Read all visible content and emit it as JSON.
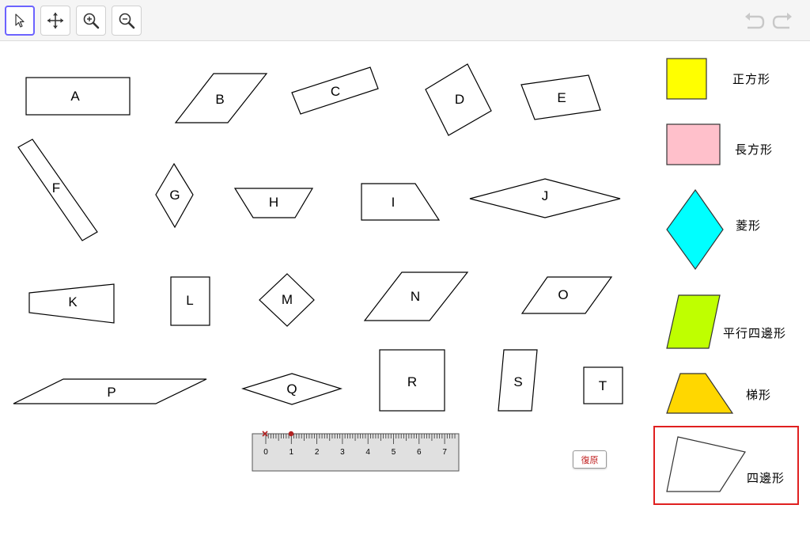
{
  "toolbar": {
    "tools": [
      {
        "name": "move-tool",
        "icon": "arrow-cursor-icon",
        "active": true
      },
      {
        "name": "move-graphics-view-tool",
        "icon": "four-arrows-icon",
        "active": false
      },
      {
        "name": "zoom-in-tool",
        "icon": "zoom-in-icon",
        "active": false
      },
      {
        "name": "zoom-out-tool",
        "icon": "zoom-out-icon",
        "active": false
      }
    ],
    "undo_icon": "undo-icon",
    "redo_icon": "redo-icon"
  },
  "shapes": {
    "A": "A",
    "B": "B",
    "C": "C",
    "D": "D",
    "E": "E",
    "F": "F",
    "G": "G",
    "H": "H",
    "I": "I",
    "J": "J",
    "K": "K",
    "L": "L",
    "M": "M",
    "N": "N",
    "O": "O",
    "P": "P",
    "Q": "Q",
    "R": "R",
    "S": "S",
    "T": "T"
  },
  "ruler": {
    "ticks": [
      "0",
      "1",
      "2",
      "3",
      "4",
      "5",
      "6",
      "7"
    ]
  },
  "reset_button": "復原",
  "categories": [
    {
      "label": "正方形",
      "color": "#ffff00"
    },
    {
      "label": "長方形",
      "color": "#ffc0cb"
    },
    {
      "label": "菱形",
      "color": "#00ffff"
    },
    {
      "label": "平行四邊形",
      "color": "#bfff00"
    },
    {
      "label": "梯形",
      "color": "#ffd700"
    },
    {
      "label": "四邊形",
      "color": "#ffffff",
      "selected": true
    }
  ],
  "colors": {
    "active_tool_border": "#6c63ff",
    "selection_border": "#e02020",
    "ruler_fill": "#e0e0e0",
    "ruler_point": "#b22222"
  }
}
